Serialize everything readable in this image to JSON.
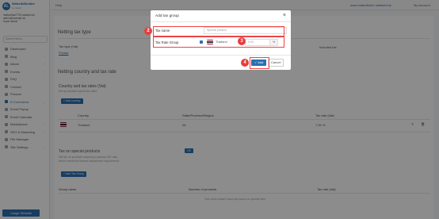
{
  "sidebar": {
    "logo_text": "AL",
    "brand": "WebsiteBuilder",
    "brand_sub": "by Velvet",
    "user_line1": "maflaoNaaT733-maliaorit.sk",
    "user_line2": "admin@example.sk",
    "user_line3": "Super Admin",
    "search_placeholder": "Search Menu",
    "items": [
      {
        "label": "Dashboard"
      },
      {
        "label": "Blog"
      },
      {
        "label": "Album"
      },
      {
        "label": "Events"
      },
      {
        "label": "FAQ"
      },
      {
        "label": "Contact"
      },
      {
        "label": "Product"
      },
      {
        "label": "E-Commerce"
      },
      {
        "label": "Event Popup"
      },
      {
        "label": "Event Calendar"
      },
      {
        "label": "Marketplace"
      },
      {
        "label": "SEO & Marketing"
      },
      {
        "label": "File Manager"
      },
      {
        "label": "Site Settings"
      }
    ],
    "footer_button": "Usage Website"
  },
  "topbar": {
    "help": "Help",
    "website": "www.mafaoNa01-maliaorit.sk",
    "account": "My Account"
  },
  "page": {
    "netting_tax_type": "Netting tax type",
    "tax_type_label": "Tax type (Vat)",
    "tax_type_value": "Private",
    "included_tax": "Included tax",
    "netting_country": "Netting country and tax rate",
    "country_rates": "Country and tax rates (Vat)",
    "country_desc": "Set up taxation based tax rates",
    "add_country": "+ Add country",
    "col_country": "Country",
    "col_state": "State/Province/Region",
    "col_taxrate": "Tax rate (Vat)",
    "row_country": "Thailand",
    "row_state": "All",
    "row_rate": "7.00 %",
    "special_title": "Tax on special products",
    "special_desc1": "Set tax on products requiring a special VAT rate,",
    "special_desc2": "which meets the finance department requirement.",
    "special_toggle": "Off",
    "add_tax_group": "+ Add Tax Group",
    "col_group": "Group name",
    "col_products": "Number of products",
    "col_rate2": "Tax rate (Vat)",
    "empty_text": "Your store doesn't have any taxes on special item"
  },
  "modal": {
    "title": "Add tax group",
    "close": "×",
    "tax_name_label": "Tax name",
    "tax_name_placeholder": "Special product",
    "tax_rate_group_label": "Tax Rate Group",
    "country": "Thailand",
    "rate_placeholder": "0.00",
    "percent": "%",
    "add_button": "✓ Add",
    "cancel_button": "Cancel"
  },
  "annotations": [
    "2",
    "3",
    "4"
  ]
}
